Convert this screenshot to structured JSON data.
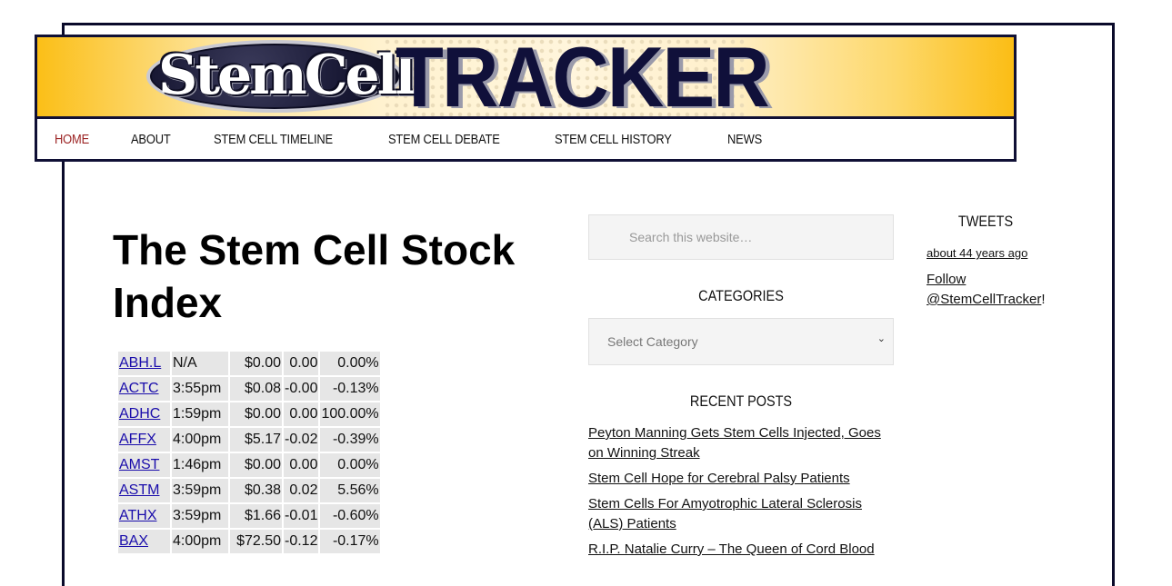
{
  "header": {
    "logo_stem": "StemCell",
    "logo_tracker": "TRACKER"
  },
  "nav": {
    "items": [
      "Home",
      "About",
      "Stem Cell Timeline",
      "Stem Cell Debate",
      "Stem Cell History",
      "News"
    ],
    "active_index": 0
  },
  "main": {
    "title": "The Stem Cell Stock Index",
    "stocks": [
      {
        "symbol": "ABH.L",
        "time": "N/A",
        "price": "$0.00",
        "change": "0.00",
        "pct": "0.00%"
      },
      {
        "symbol": "ACTC",
        "time": "3:55pm",
        "price": "$0.08",
        "change": "-0.00",
        "pct": "-0.13%"
      },
      {
        "symbol": "ADHC",
        "time": "1:59pm",
        "price": "$0.00",
        "change": "0.00",
        "pct": "100.00%"
      },
      {
        "symbol": "AFFX",
        "time": "4:00pm",
        "price": "$5.17",
        "change": "-0.02",
        "pct": "-0.39%"
      },
      {
        "symbol": "AMST",
        "time": "1:46pm",
        "price": "$0.00",
        "change": "0.00",
        "pct": "0.00%"
      },
      {
        "symbol": "ASTM",
        "time": "3:59pm",
        "price": "$0.38",
        "change": "0.02",
        "pct": "5.56%"
      },
      {
        "symbol": "ATHX",
        "time": "3:59pm",
        "price": "$1.66",
        "change": "-0.01",
        "pct": "-0.60%"
      },
      {
        "symbol": "BAX",
        "time": "4:00pm",
        "price": "$72.50",
        "change": "-0.12",
        "pct": "-0.17%"
      }
    ]
  },
  "sidebar": {
    "search_placeholder": "Search this website…",
    "categories_title": "Categories",
    "categories_select": "Select Category",
    "recent_posts_title": "Recent Posts",
    "recent_posts": [
      "Peyton Manning Gets Stem Cells Injected, Goes on Winning Streak",
      "Stem Cell Hope for Cerebral Palsy Patients",
      "Stem Cells For Amyotrophic Lateral Sclerosis (ALS) Patients",
      "R.I.P. Natalie Curry – The Queen of Cord Blood"
    ]
  },
  "tweets": {
    "title": "Tweets",
    "time": "about 44 years ago",
    "follow_prefix": "Follow ",
    "follow_handle": "@StemCellTracker",
    "follow_suffix": "!"
  }
}
